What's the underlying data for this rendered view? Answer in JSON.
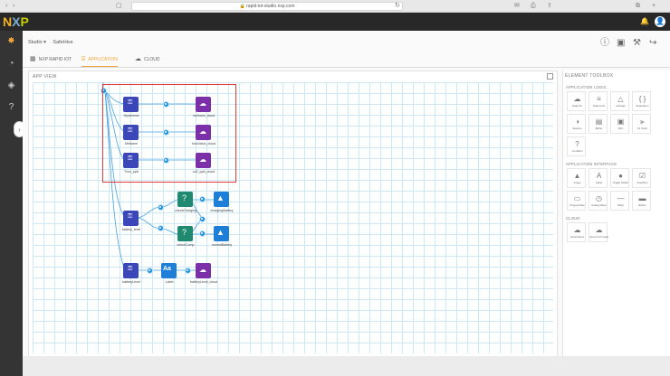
{
  "browser": {
    "url": "rapid-iot-studio.nxp.com",
    "icons": [
      "back-icon",
      "forward-icon",
      "sidebar-icon",
      "lock-icon",
      "reload-icon",
      "mail-icon",
      "print-icon",
      "share-icon",
      "tabs-icon",
      "plus-icon"
    ]
  },
  "header": {
    "logo": {
      "n": "N",
      "x": "X",
      "p": "P"
    },
    "notification_icon": "bell-icon",
    "user_icon": "user-icon"
  },
  "sidebar": {
    "items": [
      "logo-icon",
      "dashboard-icon",
      "cube-icon",
      "help-icon"
    ],
    "toggle": "›"
  },
  "breadcrumb": {
    "studio": "Studio ▾",
    "project": "SafeHive"
  },
  "toolbar": {
    "info": "ⓘ",
    "save": "💾",
    "build": "🔨",
    "share": "↪"
  },
  "tabs": [
    {
      "label": "NXP RAPID IOT",
      "icon": "chip-icon"
    },
    {
      "label": "APPLICATION",
      "icon": "app-icon"
    },
    {
      "label": "CLOUD",
      "icon": "cloud-icon"
    }
  ],
  "app_view": {
    "title": "APP VIEW",
    "nodes": [
      {
        "label": "Hysteresis",
        "type": "sensor"
      },
      {
        "label": "Methane",
        "type": "sensor"
      },
      {
        "label": "Tvoc_ppb",
        "type": "sensor"
      },
      {
        "label": "methane_cloud",
        "type": "cloud"
      },
      {
        "label": "tvocValue_cloud",
        "type": "cloud"
      },
      {
        "label": "co2_ppb_cloud",
        "type": "cloud"
      },
      {
        "label": "battery_level",
        "type": "sensor"
      },
      {
        "label": "checkCharging",
        "type": "condition"
      },
      {
        "label": "checkComp",
        "type": "condition"
      },
      {
        "label": "chargingBattery",
        "type": "image"
      },
      {
        "label": "normalBattery",
        "type": "image"
      },
      {
        "label": "batteryLevel",
        "type": "sensor"
      },
      {
        "label": "Label",
        "type": "label"
      },
      {
        "label": "batteryLevel_cloud",
        "type": "cloud"
      }
    ]
  },
  "toolbox": {
    "title": "ELEMENT TOOLBOX",
    "sections": [
      {
        "title": "APPLICATION LOGIC",
        "items": [
          {
            "label": "Data I/O",
            "icon": "cloud-icon"
          },
          {
            "label": "Data Limit",
            "icon": "limit-icon"
          },
          {
            "label": "Average",
            "icon": "average-icon"
          },
          {
            "label": "Expression",
            "icon": "expression-icon"
          },
          {
            "label": "Selector",
            "icon": "selector-icon"
          },
          {
            "label": "Buffer",
            "icon": "buffer-icon"
          },
          {
            "label": "NFC",
            "icon": "nfc-icon"
          },
          {
            "label": "Fir Tooth",
            "icon": "fir-icon"
          },
          {
            "label": "Condition",
            "icon": "condition-icon"
          }
        ]
      },
      {
        "title": "APPLICATION INTERFACE",
        "items": [
          {
            "label": "Image",
            "icon": "image-icon"
          },
          {
            "label": "Label",
            "icon": "label-icon"
          },
          {
            "label": "Toggle Switch",
            "icon": "toggle-icon"
          },
          {
            "label": "Checkbox",
            "icon": "checkbox-icon"
          },
          {
            "label": "Progress Bar",
            "icon": "progress-icon"
          },
          {
            "label": "Analog Meter",
            "icon": "meter-icon"
          },
          {
            "label": "Slider",
            "icon": "slider-icon"
          },
          {
            "label": "Button",
            "icon": "button-icon"
          }
        ]
      },
      {
        "title": "CLOUD",
        "items": [
          {
            "label": "Cloud Event",
            "icon": "cloud-event-icon"
          },
          {
            "label": "Cloud Command",
            "icon": "cloud-command-icon"
          }
        ]
      }
    ]
  },
  "colors": {
    "accent": "#f0a63a",
    "sensor": "#3b46b8",
    "cloud": "#7b2fa8",
    "condition": "#1f8a70",
    "image": "#1e7fd8",
    "port": "#1e90d8",
    "selection": "#e23b3b"
  }
}
